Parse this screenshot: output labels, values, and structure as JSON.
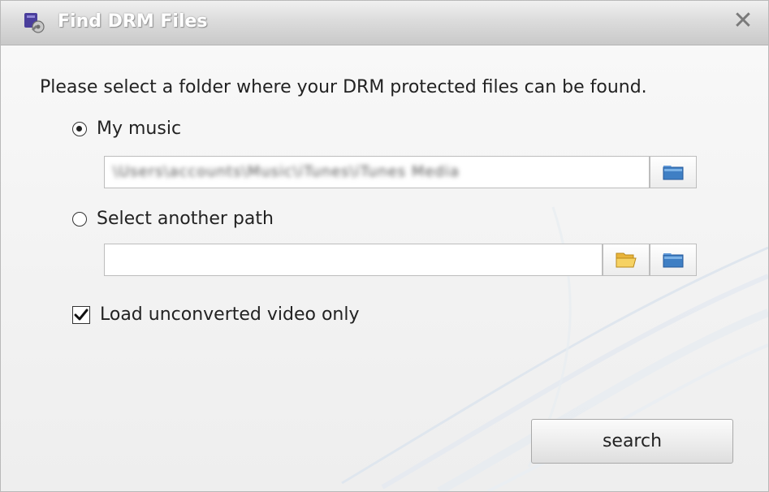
{
  "window": {
    "title": "Find DRM Files",
    "close_glyph": "✕"
  },
  "instruction": "Please select a folder where your DRM protected files can be found.",
  "options": [
    {
      "label": "My music",
      "selected": true,
      "path_value": "\\Users\\accounts\\Music\\iTunes\\iTunes Media",
      "path_blurred": true,
      "buttons": [
        "blue-folder-icon"
      ]
    },
    {
      "label": "Select another path",
      "selected": false,
      "path_value": "",
      "buttons": [
        "open-folder-icon",
        "blue-folder-icon"
      ]
    }
  ],
  "checkbox": {
    "label": "Load unconverted video only",
    "checked": true
  },
  "search_button": {
    "label": "search"
  },
  "colors": {
    "title_bar": "#d6d6d6",
    "folder_blue": "#3f7fc4",
    "folder_yellow": "#f1c84b"
  }
}
